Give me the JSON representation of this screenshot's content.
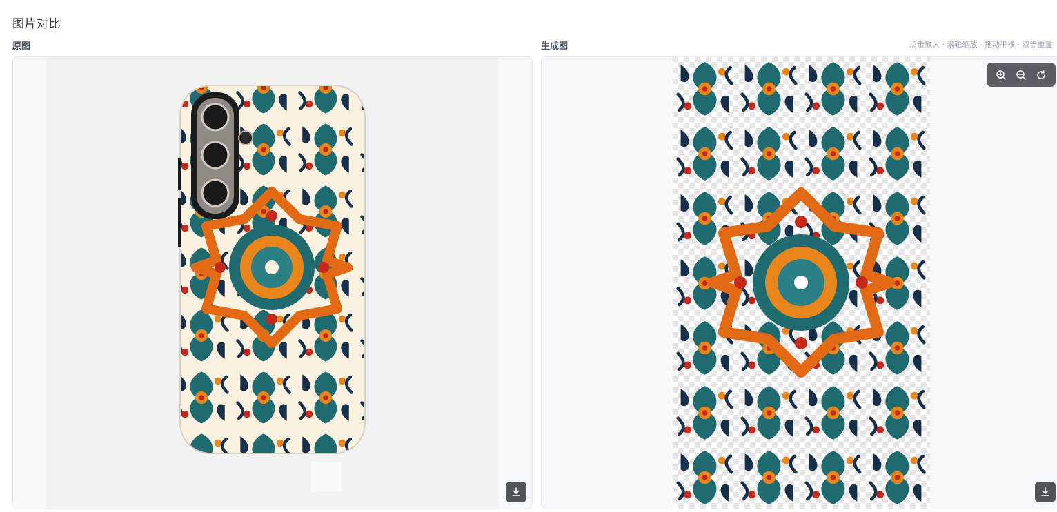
{
  "page": {
    "title": "图片对比"
  },
  "panels": {
    "original": {
      "label": "原图"
    },
    "generated": {
      "label": "生成图"
    }
  },
  "hint": "点击放大 · 滚轮缩放 · 拖动平移 · 双击重置",
  "toolbar": {
    "icons": [
      "zoom-in-icon",
      "zoom-out-icon",
      "reset-icon"
    ]
  },
  "download": {
    "icon": "download-icon"
  },
  "colors": {
    "cream": "#fbf1e0",
    "navy": "#162f4a",
    "teal": "#1f6b70",
    "orange": "#e8861c",
    "red": "#c4291c",
    "olive": "#9a8a2a"
  }
}
